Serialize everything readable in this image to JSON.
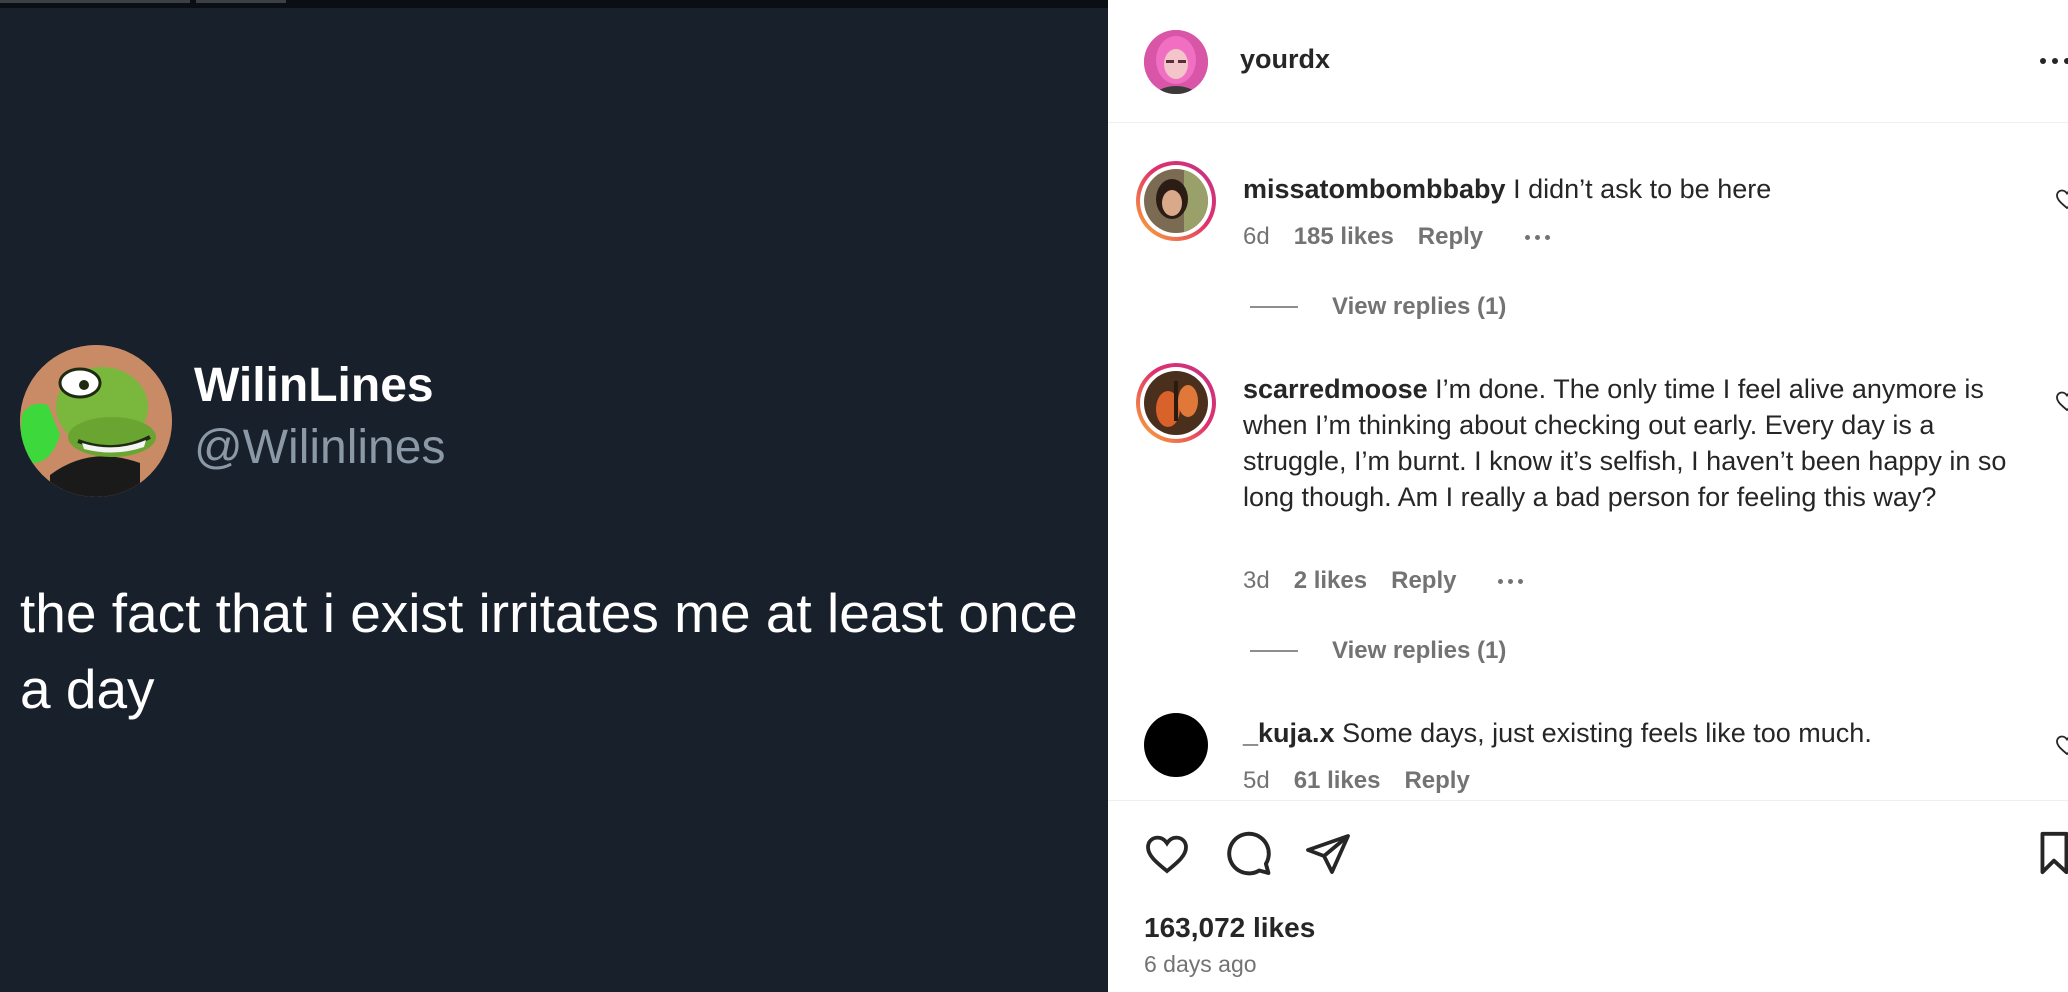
{
  "tweet": {
    "display_name": "WilinLines",
    "handle": "@Wilinlines",
    "text": "the fact that i exist irritates me at least once a day"
  },
  "post": {
    "owner_username": "yourdx",
    "likes_count": "163,072 likes",
    "posted_ago": "6 days ago"
  },
  "comments": [
    {
      "username": "missatombombbaby",
      "text": "I didn’t ask to be here",
      "age": "6d",
      "likes": "185 likes",
      "reply_label": "Reply",
      "view_replies": "View replies (1)"
    },
    {
      "username": "scarredmoose",
      "text": "I’m done. The only time I feel alive anymore is when I’m thinking about checking out early. Every day is a struggle, I’m burnt. I know it’s selfish, I haven’t been happy in so long though. Am I really a bad person for feeling this way?",
      "age": "3d",
      "likes": "2 likes",
      "reply_label": "Reply",
      "view_replies": "View replies (1)"
    },
    {
      "username": "_kuja.x",
      "text": "Some days, just existing feels like too much.",
      "age": "5d",
      "likes": "61 likes",
      "reply_label": "Reply"
    }
  ],
  "icons": {
    "like": "heart-icon",
    "comment": "comment-bubble-icon",
    "share": "paper-plane-icon",
    "save": "bookmark-icon",
    "more": "more-dots-icon"
  },
  "colors": {
    "tweet_background": "#18202b",
    "tweet_handle": "#8b98a5",
    "text_primary": "#262626",
    "text_secondary": "#737373"
  }
}
